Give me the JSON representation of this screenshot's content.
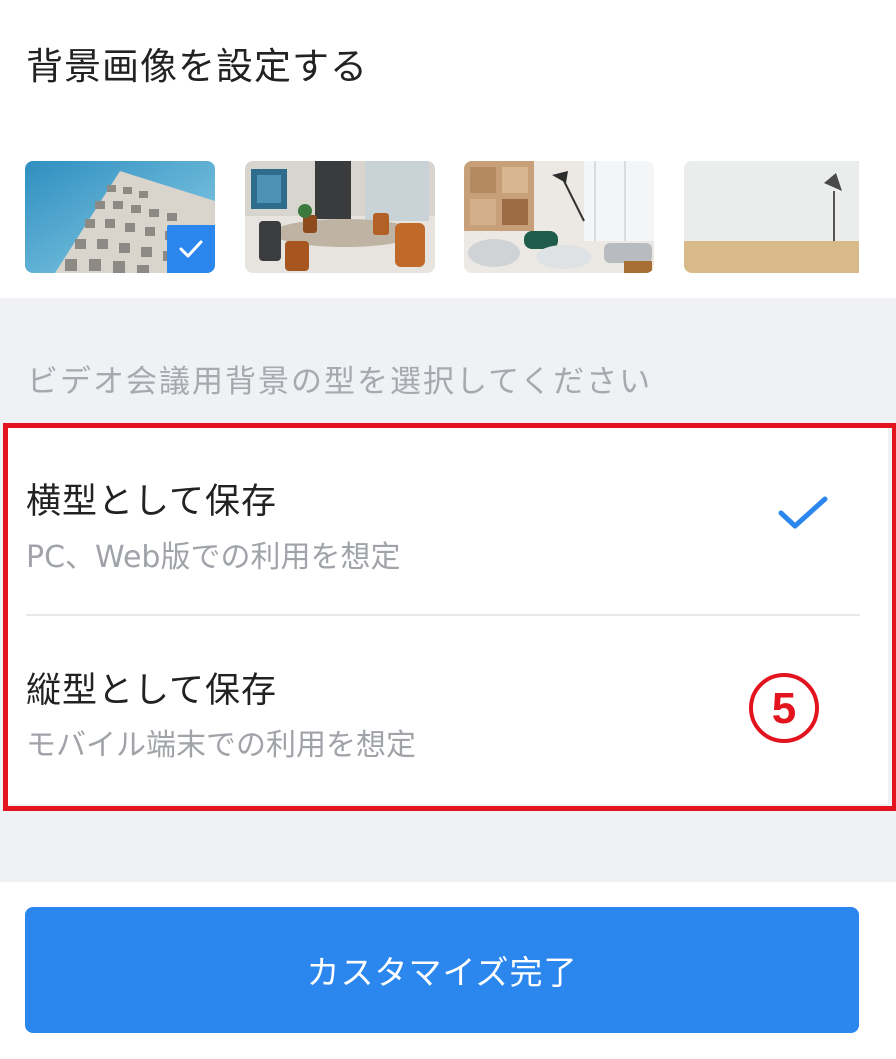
{
  "header": {
    "title": "背景画像を設定する"
  },
  "backgrounds": [
    {
      "name": "building",
      "selected": true
    },
    {
      "name": "meeting-room",
      "selected": false
    },
    {
      "name": "lounge",
      "selected": false
    },
    {
      "name": "plain-room",
      "selected": false
    }
  ],
  "orientation": {
    "label": "ビデオ会議用背景の型を選択してください",
    "options": [
      {
        "title": "横型として保存",
        "subtitle": "PC、Web版での利用を想定",
        "selected": true
      },
      {
        "title": "縦型として保存",
        "subtitle": "モバイル端末での利用を想定",
        "selected": false
      }
    ]
  },
  "annotation": {
    "step_number": "⑤",
    "highlight_color": "#e3141e"
  },
  "footer": {
    "done_label": "カスタマイズ完了"
  },
  "colors": {
    "accent": "#2b86ee",
    "page_bg": "#eff1f5"
  }
}
